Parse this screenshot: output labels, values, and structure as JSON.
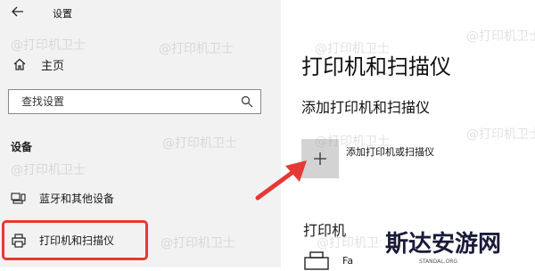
{
  "window": {
    "title": "设置"
  },
  "sidebar": {
    "home_label": "主页",
    "search_placeholder": "查找设置",
    "section_header": "设备",
    "items": [
      {
        "label": "蓝牙和其他设备",
        "icon": "bluetooth-devices-icon"
      },
      {
        "label": "打印机和扫描仪",
        "icon": "printer-icon",
        "highlighted": true
      }
    ]
  },
  "main": {
    "title": "打印机和扫描仪",
    "add_section_title": "添加打印机和扫描仪",
    "add_button_label": "添加打印机或扫描仪",
    "printers_header": "打印机",
    "printers": [
      {
        "name": "Fa"
      }
    ]
  },
  "watermark": "@打印机卫士",
  "site_logo": {
    "text": "斯达安游网",
    "subtext": "STANDAL.ORG"
  },
  "colors": {
    "sidebar_bg": "#f2f2f2",
    "highlight_border": "#e53935",
    "arrow": "#e53935",
    "add_tile": "#d3d3d3"
  }
}
